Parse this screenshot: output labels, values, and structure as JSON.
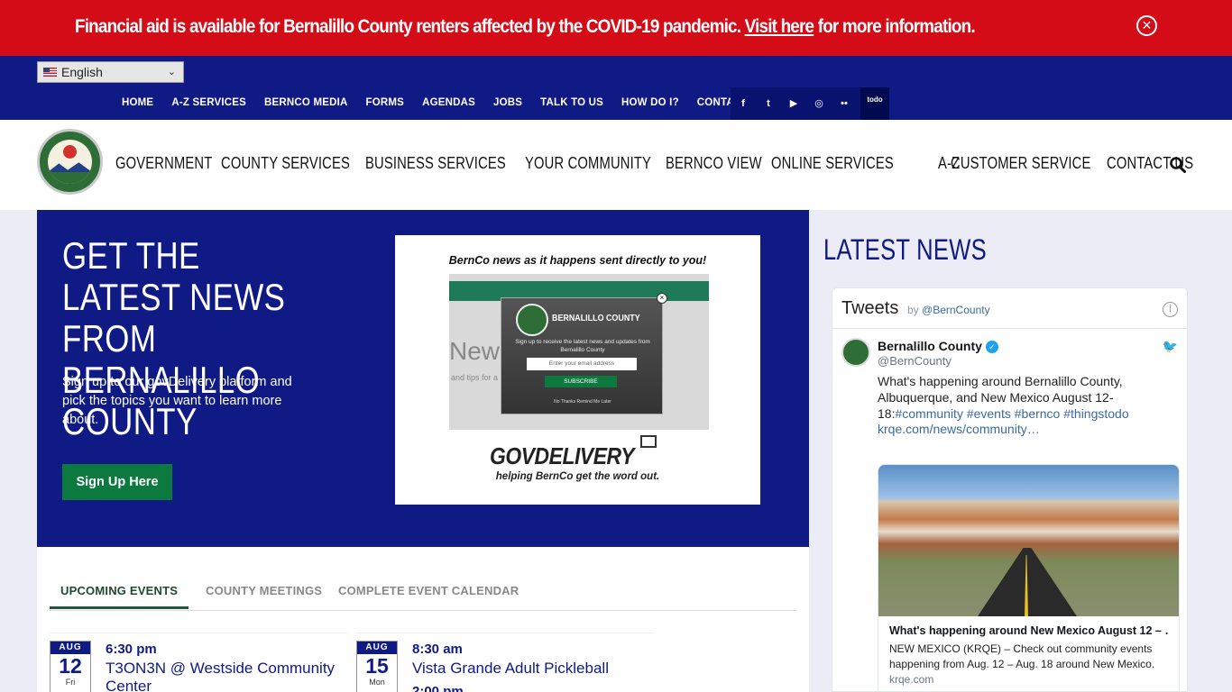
{
  "alert": {
    "text_before": "Financial aid is available for Bernalillo County renters affected by the COVID-19 pandemic.",
    "link": "Visit here",
    "text_after": "for more information.",
    "close_glyph": "×"
  },
  "language": {
    "selected": "English"
  },
  "utility_nav": [
    "HOME",
    "A-Z SERVICES",
    "BERNCO MEDIA",
    "FORMS",
    "AGENDAS",
    "JOBS",
    "TALK TO US",
    "HOW DO I?",
    "CONTACT US"
  ],
  "social": [
    {
      "name": "facebook-icon",
      "glyph": "f"
    },
    {
      "name": "twitter-icon",
      "glyph": "t"
    },
    {
      "name": "youtube-icon",
      "glyph": "▶"
    },
    {
      "name": "instagram-icon",
      "glyph": "◎"
    },
    {
      "name": "flickr-icon",
      "glyph": "••"
    },
    {
      "name": "todo-icon",
      "glyph": "todo"
    }
  ],
  "main_nav": [
    "GOVERNMENT",
    "COUNTY SERVICES",
    "BUSINESS SERVICES",
    "YOUR COMMUNITY",
    "BERNCO VIEW",
    "ONLINE SERVICES"
  ],
  "right_nav": [
    "A-Z",
    "CUSTOMER SERVICE",
    "CONTACT US"
  ],
  "hero": {
    "title": "GET THE LATEST NEWS FROM BERNALILLO COUNTY",
    "description": "Sign up to our govDelivery platform and pick the topics you want to learn more about.",
    "button": "Sign Up Here",
    "promo": {
      "caption": "BernCo news as it happens sent directly to you!",
      "popup_title": "BERNALILLO COUNTY",
      "popup_text": "Sign up to receive the latest news and updates from Bernalillo County",
      "popup_placeholder": "Enter your email address",
      "popup_button": "SUBSCRIBE",
      "popup_links": "No Thanks      Remind Me Later",
      "ghost_text": "New",
      "ghost_text2": "and tips for a",
      "logo": "GOVDELIVERY",
      "tagline": "helping BernCo get the word out."
    }
  },
  "events": {
    "tabs": [
      "UPCOMING EVENTS",
      "COUNTY MEETINGS",
      "COMPLETE EVENT CALENDAR"
    ],
    "items": [
      {
        "month": "AUG",
        "day": "12",
        "weekday": "Fri",
        "time": "6:30 pm",
        "title": "T3ON3N @ Westside Community Center",
        "time2": ""
      },
      {
        "month": "AUG",
        "day": "15",
        "weekday": "Mon",
        "time": "8:30 am",
        "title": "Vista Grande Adult Pickleball",
        "time2": "2:00 pm"
      }
    ]
  },
  "sidebar": {
    "heading": "LATEST NEWS",
    "tweets_title": "Tweets",
    "tweets_by": "by",
    "tweets_handle": "@BernCounty",
    "tweet": {
      "name": "Bernalillo County",
      "handle": "@BernCounty",
      "text": "What's happening around Bernalillo County, Albuquerque, and New Mexico August 12-18:",
      "hashtags": "#community #events #bernco #thingstodo",
      "link": "krqe.com/news/community…",
      "card_title": "What's happening around New Mexico August 12 – …",
      "card_desc": "NEW MEXICO (KRQE) – Check out community events happening from Aug. 12 – Aug. 18 around New Mexico.",
      "card_url": "krqe.com"
    }
  },
  "colors": {
    "alert_red": "#d40c17",
    "navy": "#0f1a85",
    "green": "#0c7a3e"
  }
}
